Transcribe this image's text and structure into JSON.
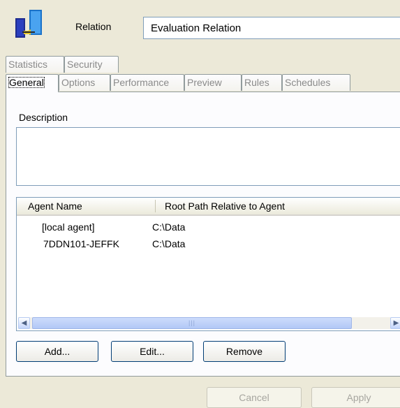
{
  "header": {
    "label": "Relation",
    "name_value": "Evaluation Relation",
    "icon": "relation-icon"
  },
  "tabs_row_back": [
    {
      "label": "Statistics"
    },
    {
      "label": "Security"
    }
  ],
  "tabs_row_front": [
    {
      "label": "General",
      "active": true
    },
    {
      "label": "Options"
    },
    {
      "label": "Performance"
    },
    {
      "label": "Preview"
    },
    {
      "label": "Rules"
    },
    {
      "label": "Schedules"
    }
  ],
  "general": {
    "description_label": "Description",
    "description_value": "",
    "agents_table": {
      "columns": [
        "Agent Name",
        "Root Path Relative to Agent"
      ],
      "rows": [
        {
          "agent": "[local agent]",
          "path": "C:\\Data"
        },
        {
          "agent": "7DDN101-JEFFK",
          "path": "C:\\Data"
        }
      ]
    },
    "buttons": {
      "add": "Add...",
      "edit": "Edit...",
      "remove": "Remove"
    }
  },
  "footer": {
    "cancel": "Cancel",
    "apply": "Apply"
  },
  "colors": {
    "dialog_bg": "#ece9d8",
    "border_blue": "#7f9db9",
    "button_border": "#003c74"
  }
}
